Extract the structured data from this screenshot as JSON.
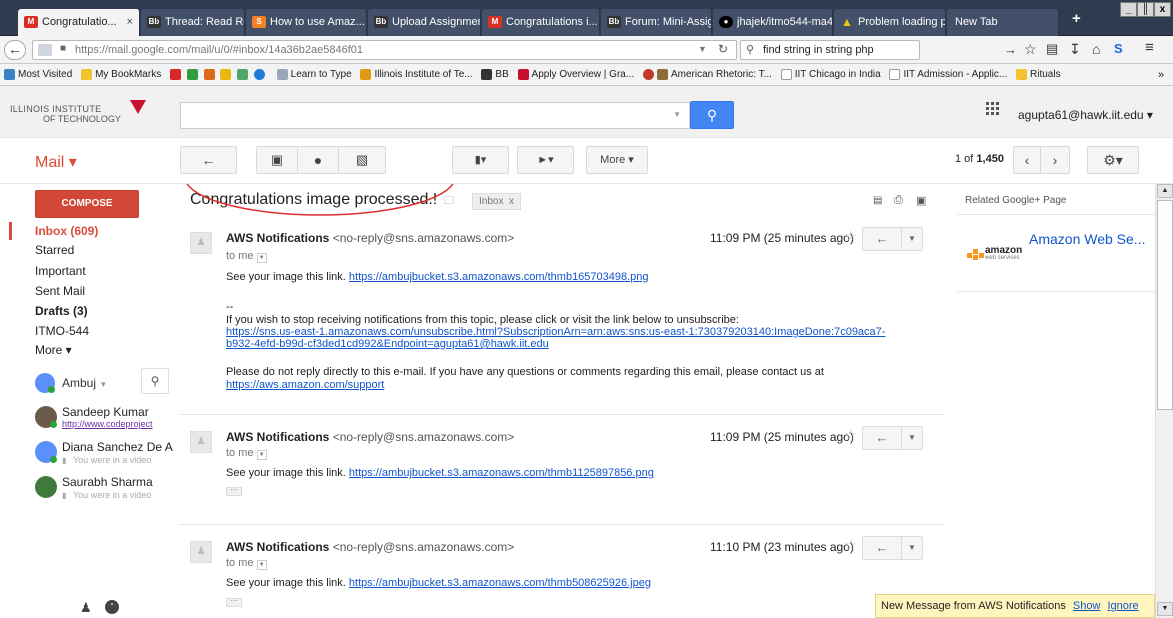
{
  "browser": {
    "tabs": [
      {
        "label": "Congratulatio...",
        "icon": "gmail-icon",
        "color": "#d93025"
      },
      {
        "label": "Thread: Read Re...",
        "icon": "bb-icon",
        "color": "#333333"
      },
      {
        "label": "How to use Amaz...",
        "icon": "stackoverflow-icon",
        "color": "#f48024"
      },
      {
        "label": "Upload Assignmen...",
        "icon": "bb-icon",
        "color": "#333333"
      },
      {
        "label": "Congratulations i...",
        "icon": "gmail-icon",
        "color": "#d93025"
      },
      {
        "label": "Forum: Mini-Assig...",
        "icon": "bb-icon",
        "color": "#333333"
      },
      {
        "label": "jhajek/itmo544-ma4",
        "icon": "github-icon",
        "color": "#000000"
      },
      {
        "label": "Problem loading p...",
        "icon": "warning-icon",
        "color": "#f1c40f"
      },
      {
        "label": "New Tab",
        "icon": "",
        "color": ""
      }
    ],
    "close_tab": "×",
    "new_tab": "+",
    "window_controls": [
      "_",
      "║",
      "x"
    ],
    "url": "https://mail.google.com/mail/u/0/#inbox/14a36b2ae5846f01",
    "url_bold": "mail.google.com",
    "search_value": "find string in string php",
    "bookmarks": [
      "Most Visited",
      "My BookMarks",
      "Learn to Type",
      "Illinois Institute of Te...",
      "BB",
      "Apply Overview | Gra...",
      "American Rhetoric: T...",
      "IIT Chicago in India",
      "IIT Admission - Applic...",
      "Rituals"
    ],
    "overflow": "»"
  },
  "gmail": {
    "logo_line1": "ILLINOIS INSTITUTE",
    "logo_line2": "OF TECHNOLOGY",
    "account": "agupta61@hawk.iit.edu ▾",
    "mail_label": "Mail ▾",
    "more_label": "More ▾",
    "pager": "1 of",
    "pager_total": "1,450",
    "compose": "COMPOSE",
    "nav": [
      {
        "label": "Inbox (609)",
        "bold": true,
        "red": true
      },
      {
        "label": "Starred",
        "bold": false
      },
      {
        "label": "Important",
        "bold": false
      },
      {
        "label": "Sent Mail",
        "bold": false
      },
      {
        "label": "Drafts (3)",
        "bold": true
      },
      {
        "label": "ITMO-544",
        "bold": false
      },
      {
        "label": "More ▾",
        "bold": false
      }
    ],
    "chat_user": "Ambuj",
    "contacts": [
      {
        "name": "Sandeep Kumar",
        "status": "http://www.codeproject"
      },
      {
        "name": "Diana Sanchez De A",
        "status": "You were in a video"
      },
      {
        "name": "Saurabh Sharma",
        "status": "You were in a video"
      }
    ],
    "subject": "Congratulations image processed.!",
    "label_chip": "Inbox",
    "label_x": "x",
    "related": "Related Google+ Page",
    "related_name": "Amazon Web Se...",
    "aws_logo": "amazon",
    "aws_sub": "web services",
    "messages": [
      {
        "sender": "AWS Notifications",
        "email": "<no-reply@sns.amazonaws.com>",
        "to": "to me",
        "time": "11:09 PM (25 minutes ago)",
        "line1_text": "See your image this link.",
        "line1_link": "https://ambujbucket.s3.amazonaws.com/thmb165703498.png",
        "sig": "--",
        "unsub_text": "If you wish to stop receiving notifications from this topic, please click or visit the link below to unsubscribe:",
        "unsub_link1": "https://sns.us-east-1.amazonaws.com/unsubscribe.html?SubscriptionArn=arn:aws:sns:us-east-1:730379203140:ImageDone:7c09aca7-",
        "unsub_link2": "b932-4efd-b99d-cf3ded1cd992&Endpoint=agupta61@hawk.iit.edu",
        "noreply_text": "Please do not reply directly to this e-mail. If you have any questions or comments regarding this email, please contact us at",
        "support_link": "https://aws.amazon.com/support"
      },
      {
        "sender": "AWS Notifications",
        "email": "<no-reply@sns.amazonaws.com>",
        "to": "to me",
        "time": "11:09 PM (25 minutes ago)",
        "line1_text": "See your image this link.",
        "line1_link": "https://ambujbucket.s3.amazonaws.com/thmb1125897856.png"
      },
      {
        "sender": "AWS Notifications",
        "email": "<no-reply@sns.amazonaws.com>",
        "to": "to me",
        "time": "11:10 PM (23 minutes ago)",
        "line1_text": "See your image this link.",
        "line1_link": "https://ambujbucket.s3.amazonaws.com/thmb508625926.jpeg"
      }
    ],
    "notification": {
      "text": "New Message from AWS Notifications",
      "show": "Show",
      "ignore": "Ignore"
    }
  }
}
